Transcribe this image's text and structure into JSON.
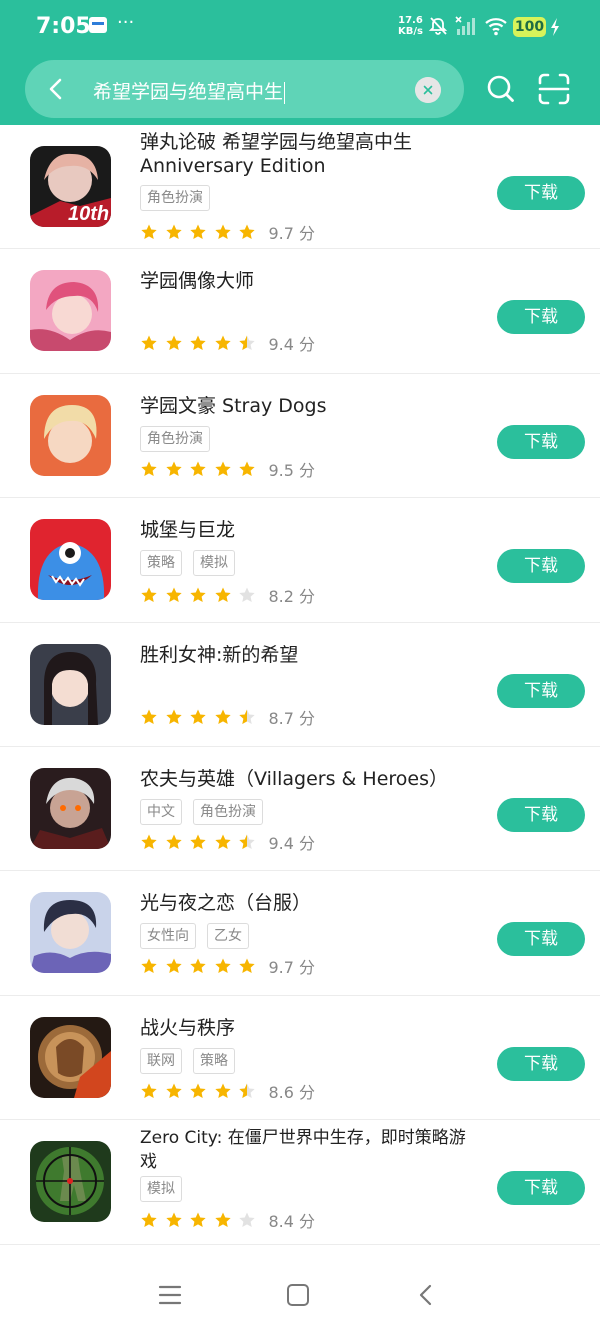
{
  "status_bar": {
    "time": "7:05",
    "dots": "···",
    "net_speed_value": "17.6",
    "net_speed_unit": "KB/s",
    "battery": "100"
  },
  "search": {
    "query": "希望学园与绝望高中生",
    "icons": [
      "back-icon",
      "clear-icon",
      "search-icon",
      "scan-icon"
    ]
  },
  "results": [
    {
      "name": "弹丸论破 希望学园与绝望高中生 Anniversary Edition",
      "tags": [
        "角色扮演"
      ],
      "stars": 5,
      "score": "9.7 分",
      "button": "下载"
    },
    {
      "name": "学园偶像大师",
      "tags": [],
      "stars": 4.5,
      "score": "9.4 分",
      "button": "下载"
    },
    {
      "name": "学园文豪 Stray Dogs",
      "tags": [
        "角色扮演"
      ],
      "stars": 5,
      "score": "9.5 分",
      "button": "下载"
    },
    {
      "name": "城堡与巨龙",
      "tags": [
        "策略",
        "模拟"
      ],
      "stars": 4,
      "score": "8.2 分",
      "button": "下载"
    },
    {
      "name": "胜利女神:新的希望",
      "tags": [],
      "stars": 4.5,
      "score": "8.7 分",
      "button": "下载"
    },
    {
      "name": "农夫与英雄（Villagers & Heroes）",
      "tags": [
        "中文",
        "角色扮演"
      ],
      "stars": 4.5,
      "score": "9.4 分",
      "button": "下载"
    },
    {
      "name": "光与夜之恋（台服）",
      "tags": [
        "女性向",
        "乙女"
      ],
      "stars": 5,
      "score": "9.7 分",
      "button": "下载"
    },
    {
      "name": "战火与秩序",
      "tags": [
        "联网",
        "策略"
      ],
      "stars": 4.5,
      "score": "8.6 分",
      "button": "下载"
    },
    {
      "name": "Zero City: 在僵尸世界中生存，即时策略游戏",
      "tags": [
        "模拟"
      ],
      "stars": 4,
      "score": "8.4 分",
      "button": "下载"
    }
  ],
  "colors": {
    "accent": "#2bbf9c",
    "star": "#f7b500",
    "star_empty": "#e2e2e2"
  }
}
